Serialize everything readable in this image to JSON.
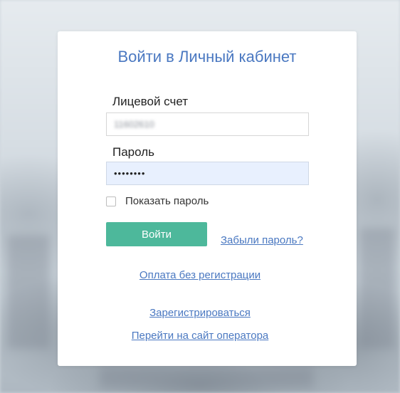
{
  "login": {
    "title": "Войти в Личный кабинет",
    "account_label": "Лицевой счет",
    "account_value": "11602610",
    "password_label": "Пароль",
    "password_value": "••••••••",
    "show_password_label": "Показать пароль",
    "submit_label": "Войти",
    "forgot_password_label": "Забыли пароль?",
    "pay_without_registration_label": "Оплата без регистрации",
    "register_label": "Зарегистрироваться",
    "operator_site_label": "Перейти на сайт оператора"
  },
  "colors": {
    "accent_blue": "#4a78c1",
    "button_green": "#4db89b",
    "password_fill": "#e8f0fe"
  }
}
